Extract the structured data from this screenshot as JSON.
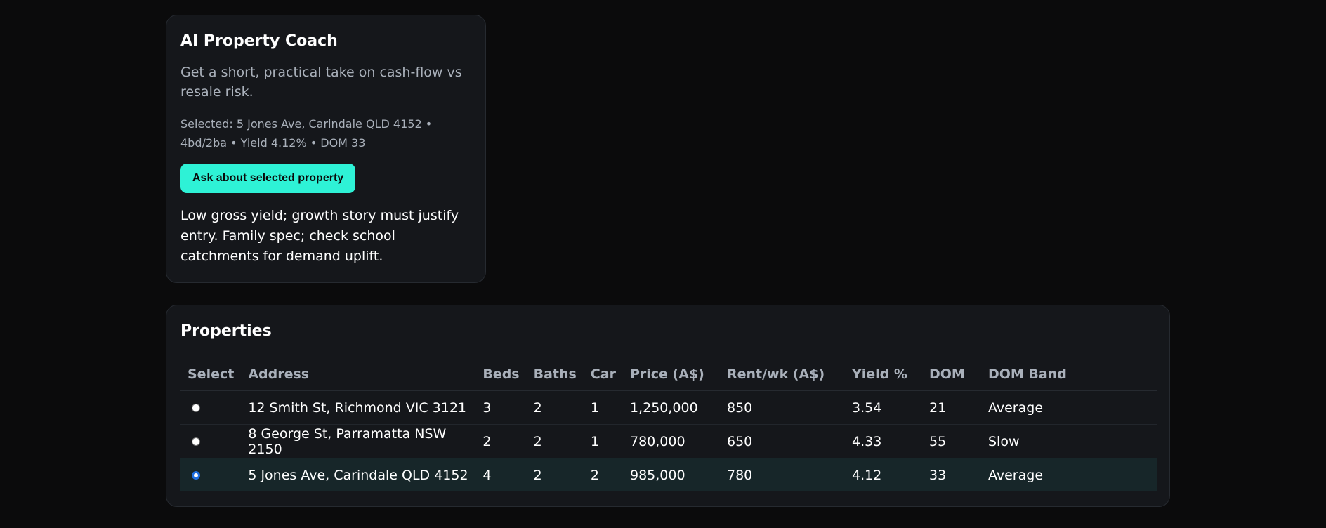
{
  "coach": {
    "title": "AI Property Coach",
    "subtitle": "Get a short, practical take on cash-flow vs resale risk.",
    "selected_text": "Selected: 5 Jones Ave, Carindale QLD 4152 • 4bd/2ba • Yield 4.12% • DOM 33",
    "ask_button_label": "Ask about selected property",
    "answer": "Low gross yield; growth story must justify entry. Family spec; check school catchments for demand uplift."
  },
  "properties": {
    "title": "Properties",
    "columns": [
      "Select",
      "Address",
      "Beds",
      "Baths",
      "Car",
      "Price (A$)",
      "Rent/wk (A$)",
      "Yield %",
      "DOM",
      "DOM Band"
    ],
    "rows": [
      {
        "selected": false,
        "address": "12 Smith St, Richmond VIC 3121",
        "beds": "3",
        "baths": "2",
        "car": "1",
        "price": "1,250,000",
        "rent": "850",
        "yield": "3.54",
        "dom": "21",
        "band": "Average"
      },
      {
        "selected": false,
        "address": "8 George St, Parramatta NSW 2150",
        "beds": "2",
        "baths": "2",
        "car": "1",
        "price": "780,000",
        "rent": "650",
        "yield": "4.33",
        "dom": "55",
        "band": "Slow"
      },
      {
        "selected": true,
        "address": "5 Jones Ave, Carindale QLD 4152",
        "beds": "4",
        "baths": "2",
        "car": "2",
        "price": "985,000",
        "rent": "780",
        "yield": "4.12",
        "dom": "33",
        "band": "Average"
      }
    ]
  },
  "colors": {
    "accent": "#2ef2d6",
    "background": "#0b0b0c",
    "card": "#15171b",
    "selected_row": "#172629"
  }
}
